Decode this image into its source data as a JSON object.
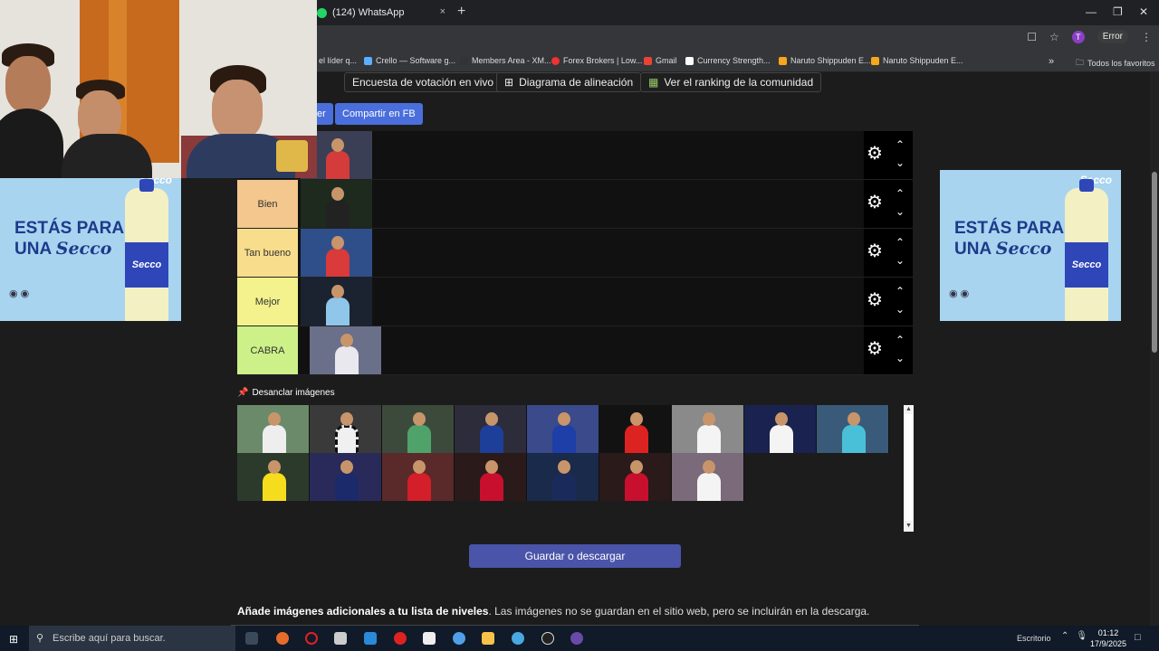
{
  "browser": {
    "tab_title": "(124) WhatsApp",
    "tab_close": "×",
    "new_tab": "+",
    "error_label": "Error",
    "profile_initial": "T",
    "bookmarks": [
      {
        "label": "el líder q..."
      },
      {
        "label": "Crello — Software g..."
      },
      {
        "label": "Members Area - XM..."
      },
      {
        "label": "Forex Brokers | Low..."
      },
      {
        "label": "Gmail"
      },
      {
        "label": "Currency Strength..."
      },
      {
        "label": "Naruto Shippuden E..."
      },
      {
        "label": "Naruto Shippuden E..."
      }
    ],
    "bookmarks_more": "»",
    "all_favorites": "Todos los favoritos"
  },
  "page": {
    "top_buttons": {
      "poll": "Encuesta de votación en vivo",
      "lineup": "Diagrama de alineación",
      "ranking": "Ver el ranking de la comunidad"
    },
    "partial_button": "er",
    "share_fb": "Compartir en FB",
    "tiers": [
      {
        "label": "",
        "color": "#111111"
      },
      {
        "label": "Bien",
        "color": "#f3c78d"
      },
      {
        "label": "Tan bueno",
        "color": "#f7dd8c"
      },
      {
        "label": "Mejor",
        "color": "#f3f28c"
      },
      {
        "label": "CABRA",
        "color": "#cdf088"
      }
    ],
    "unpin_label": "Desanclar imágenes",
    "save_button": "Guardar o descargar",
    "info_bold": "Añade imágenes adicionales a tu lista de niveles",
    "info_text": ". Las imágenes no se guardan en el sitio web, pero se incluirán en la descarga."
  },
  "ads": {
    "line1": "ESTÁS PARA",
    "line2": "UNA",
    "brand": "Secco",
    "bottle_label": "Secco"
  },
  "taskbar": {
    "search_placeholder": "Escribe aquí para buscar.",
    "desktop_label": "Escritorio",
    "time": "01:12",
    "date": "17/9/2025"
  }
}
